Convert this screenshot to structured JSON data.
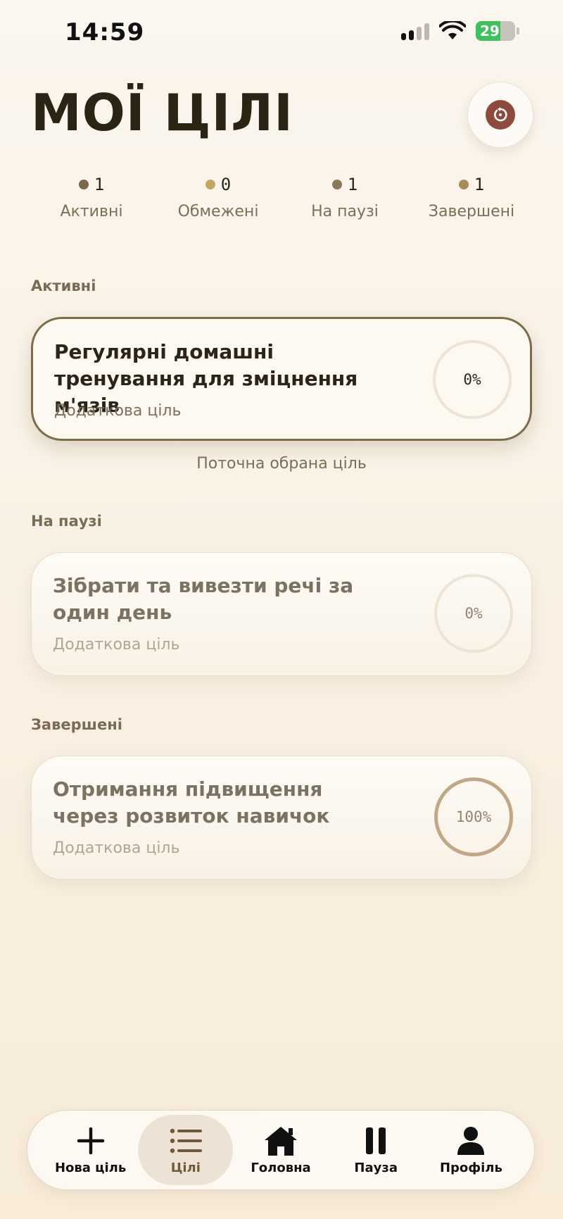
{
  "status_bar": {
    "time": "14:59",
    "battery": "29"
  },
  "header": {
    "title": "МОЇ ЦІЛІ"
  },
  "stats": [
    {
      "count": "1",
      "label": "Активні",
      "color": "#7a6a47"
    },
    {
      "count": "0",
      "label": "Обмежені",
      "color": "#c8a565"
    },
    {
      "count": "1",
      "label": "На паузі",
      "color": "#8a7a5a"
    },
    {
      "count": "1",
      "label": "Завершені",
      "color": "#a88c58"
    }
  ],
  "sections": {
    "active": {
      "label": "Активні",
      "goal": {
        "title": "Регулярні домашні тренування для зміцнення м'язів",
        "subtitle": "Додаткова ціль",
        "progress": "0%"
      },
      "current_note": "Поточна обрана ціль"
    },
    "paused": {
      "label": "На паузі",
      "goal": {
        "title": "Зібрати та вивезти речі за один день",
        "subtitle": "Додаткова ціль",
        "progress": "0%"
      }
    },
    "completed": {
      "label": "Завершені",
      "goal": {
        "title": "Отримання підвищення через розвиток навичок",
        "subtitle": "Додаткова ціль",
        "progress": "100%"
      }
    }
  },
  "tabbar": {
    "items": [
      {
        "label": "Нова ціль",
        "icon": "plus-icon"
      },
      {
        "label": "Цілі",
        "icon": "list-icon"
      },
      {
        "label": "Головна",
        "icon": "home-icon"
      },
      {
        "label": "Пауза",
        "icon": "pause-icon"
      },
      {
        "label": "Профіль",
        "icon": "person-icon"
      }
    ],
    "active_index": 1
  }
}
